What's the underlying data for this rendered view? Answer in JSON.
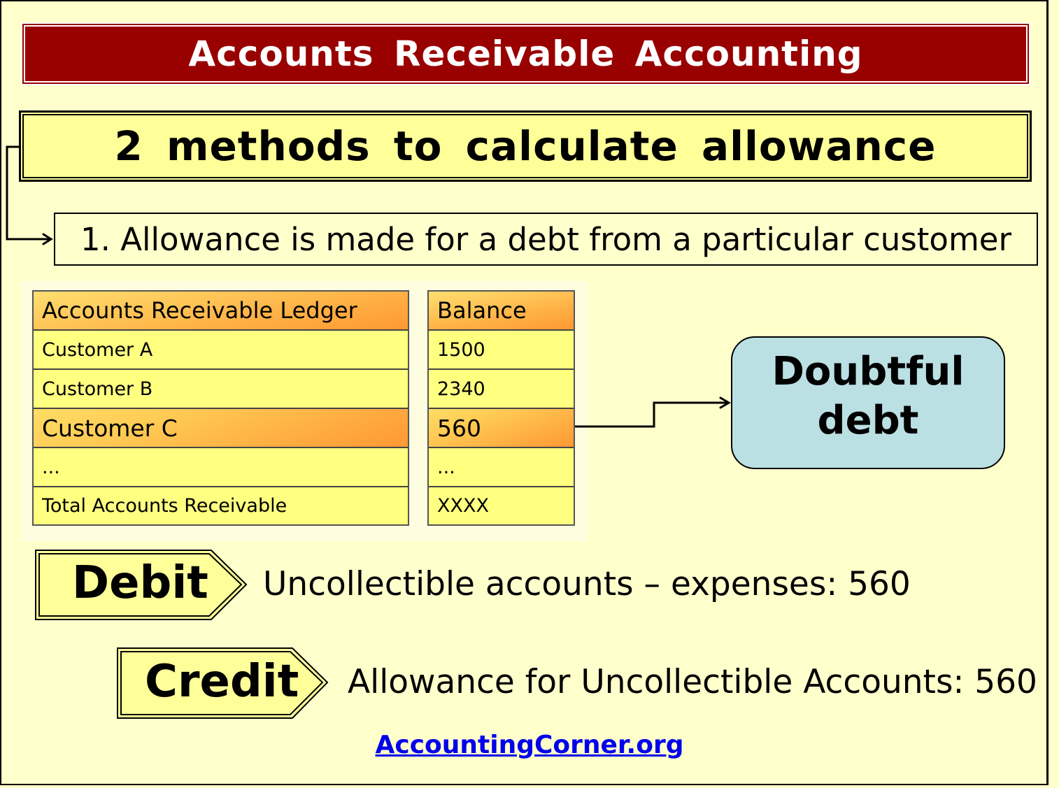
{
  "title": "Accounts Receivable Accounting",
  "subtitle": "2 methods to calculate allowance",
  "method": "1. Allowance is made for a debt from a particular customer",
  "ledger": {
    "header_left": "Accounts Receivable Ledger",
    "header_right": "Balance",
    "rows": [
      {
        "name": "Customer A",
        "balance": "1500",
        "highlight": false
      },
      {
        "name": "Customer B",
        "balance": "2340",
        "highlight": false
      },
      {
        "name": "Customer C",
        "balance": "560",
        "highlight": true
      },
      {
        "name": "...",
        "balance": "...",
        "highlight": false
      },
      {
        "name": "Total Accounts Receivable",
        "balance": "XXXX",
        "highlight": false
      }
    ]
  },
  "doubtful": {
    "line1": "Doubtful",
    "line2": "debt"
  },
  "entries": {
    "debit": {
      "label": "Debit",
      "text": "Uncollectible accounts – expenses: 560"
    },
    "credit": {
      "label": "Credit",
      "text": "Allowance for Uncollectible Accounts: 560"
    }
  },
  "footer_link": "AccountingCorner.org",
  "colors": {
    "background": "#ffffcc",
    "title_banner": "#990000",
    "subtitle_box": "#ffff99",
    "table_cell": "#ffff80",
    "table_header": "#ff9933",
    "doubtful_box": "#bbe0e3",
    "link": "#0000ee"
  }
}
